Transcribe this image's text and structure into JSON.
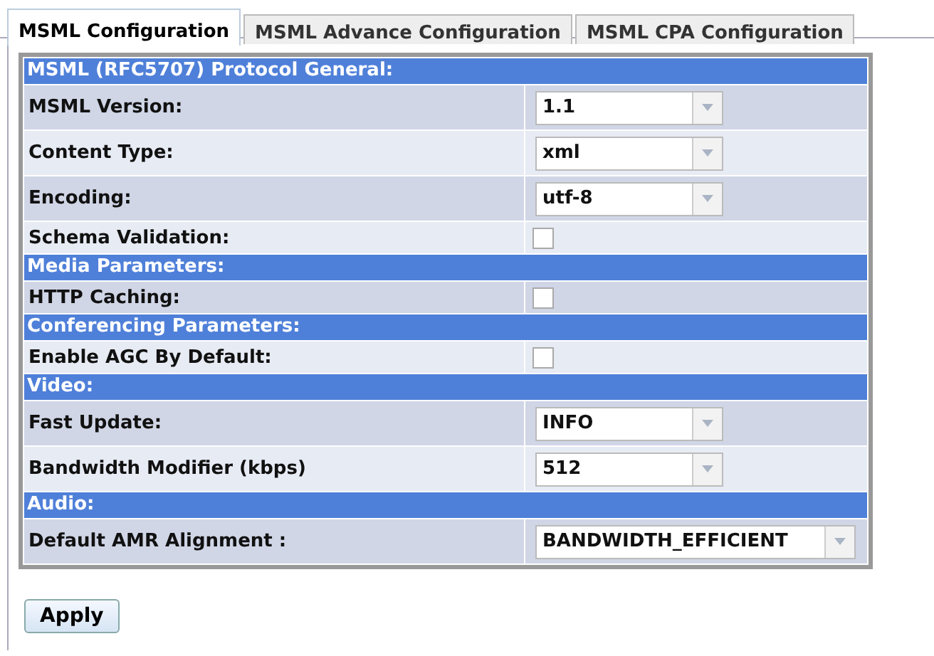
{
  "tabs": [
    {
      "label": "MSML Configuration",
      "selected": true
    },
    {
      "label": "MSML Advance Configuration",
      "selected": false
    },
    {
      "label": "MSML CPA Configuration",
      "selected": false
    }
  ],
  "rows": [
    {
      "kind": "section",
      "label": "MSML (RFC5707) Protocol General:"
    },
    {
      "kind": "select",
      "label": "MSML Version:",
      "value": "1.1"
    },
    {
      "kind": "select",
      "label": "Content Type:",
      "value": "xml"
    },
    {
      "kind": "select",
      "label": "Encoding:",
      "value": "utf-8"
    },
    {
      "kind": "checkbox",
      "label": "Schema Validation:",
      "checked": false
    },
    {
      "kind": "section",
      "label": "Media Parameters:"
    },
    {
      "kind": "checkbox",
      "label": "HTTP Caching:",
      "checked": false
    },
    {
      "kind": "section",
      "label": "Conferencing Parameters:"
    },
    {
      "kind": "checkbox",
      "label": "Enable AGC By Default:",
      "checked": false
    },
    {
      "kind": "section",
      "label": "Video:"
    },
    {
      "kind": "select",
      "label": "Fast Update:",
      "value": "INFO"
    },
    {
      "kind": "select",
      "label": "Bandwidth Modifier (kbps)",
      "value": "512"
    },
    {
      "kind": "section",
      "label": "Audio:"
    },
    {
      "kind": "select",
      "label": "Default AMR Alignment :",
      "value": "BANDWIDTH_EFFICIENT"
    }
  ],
  "apply_button": "Apply"
}
